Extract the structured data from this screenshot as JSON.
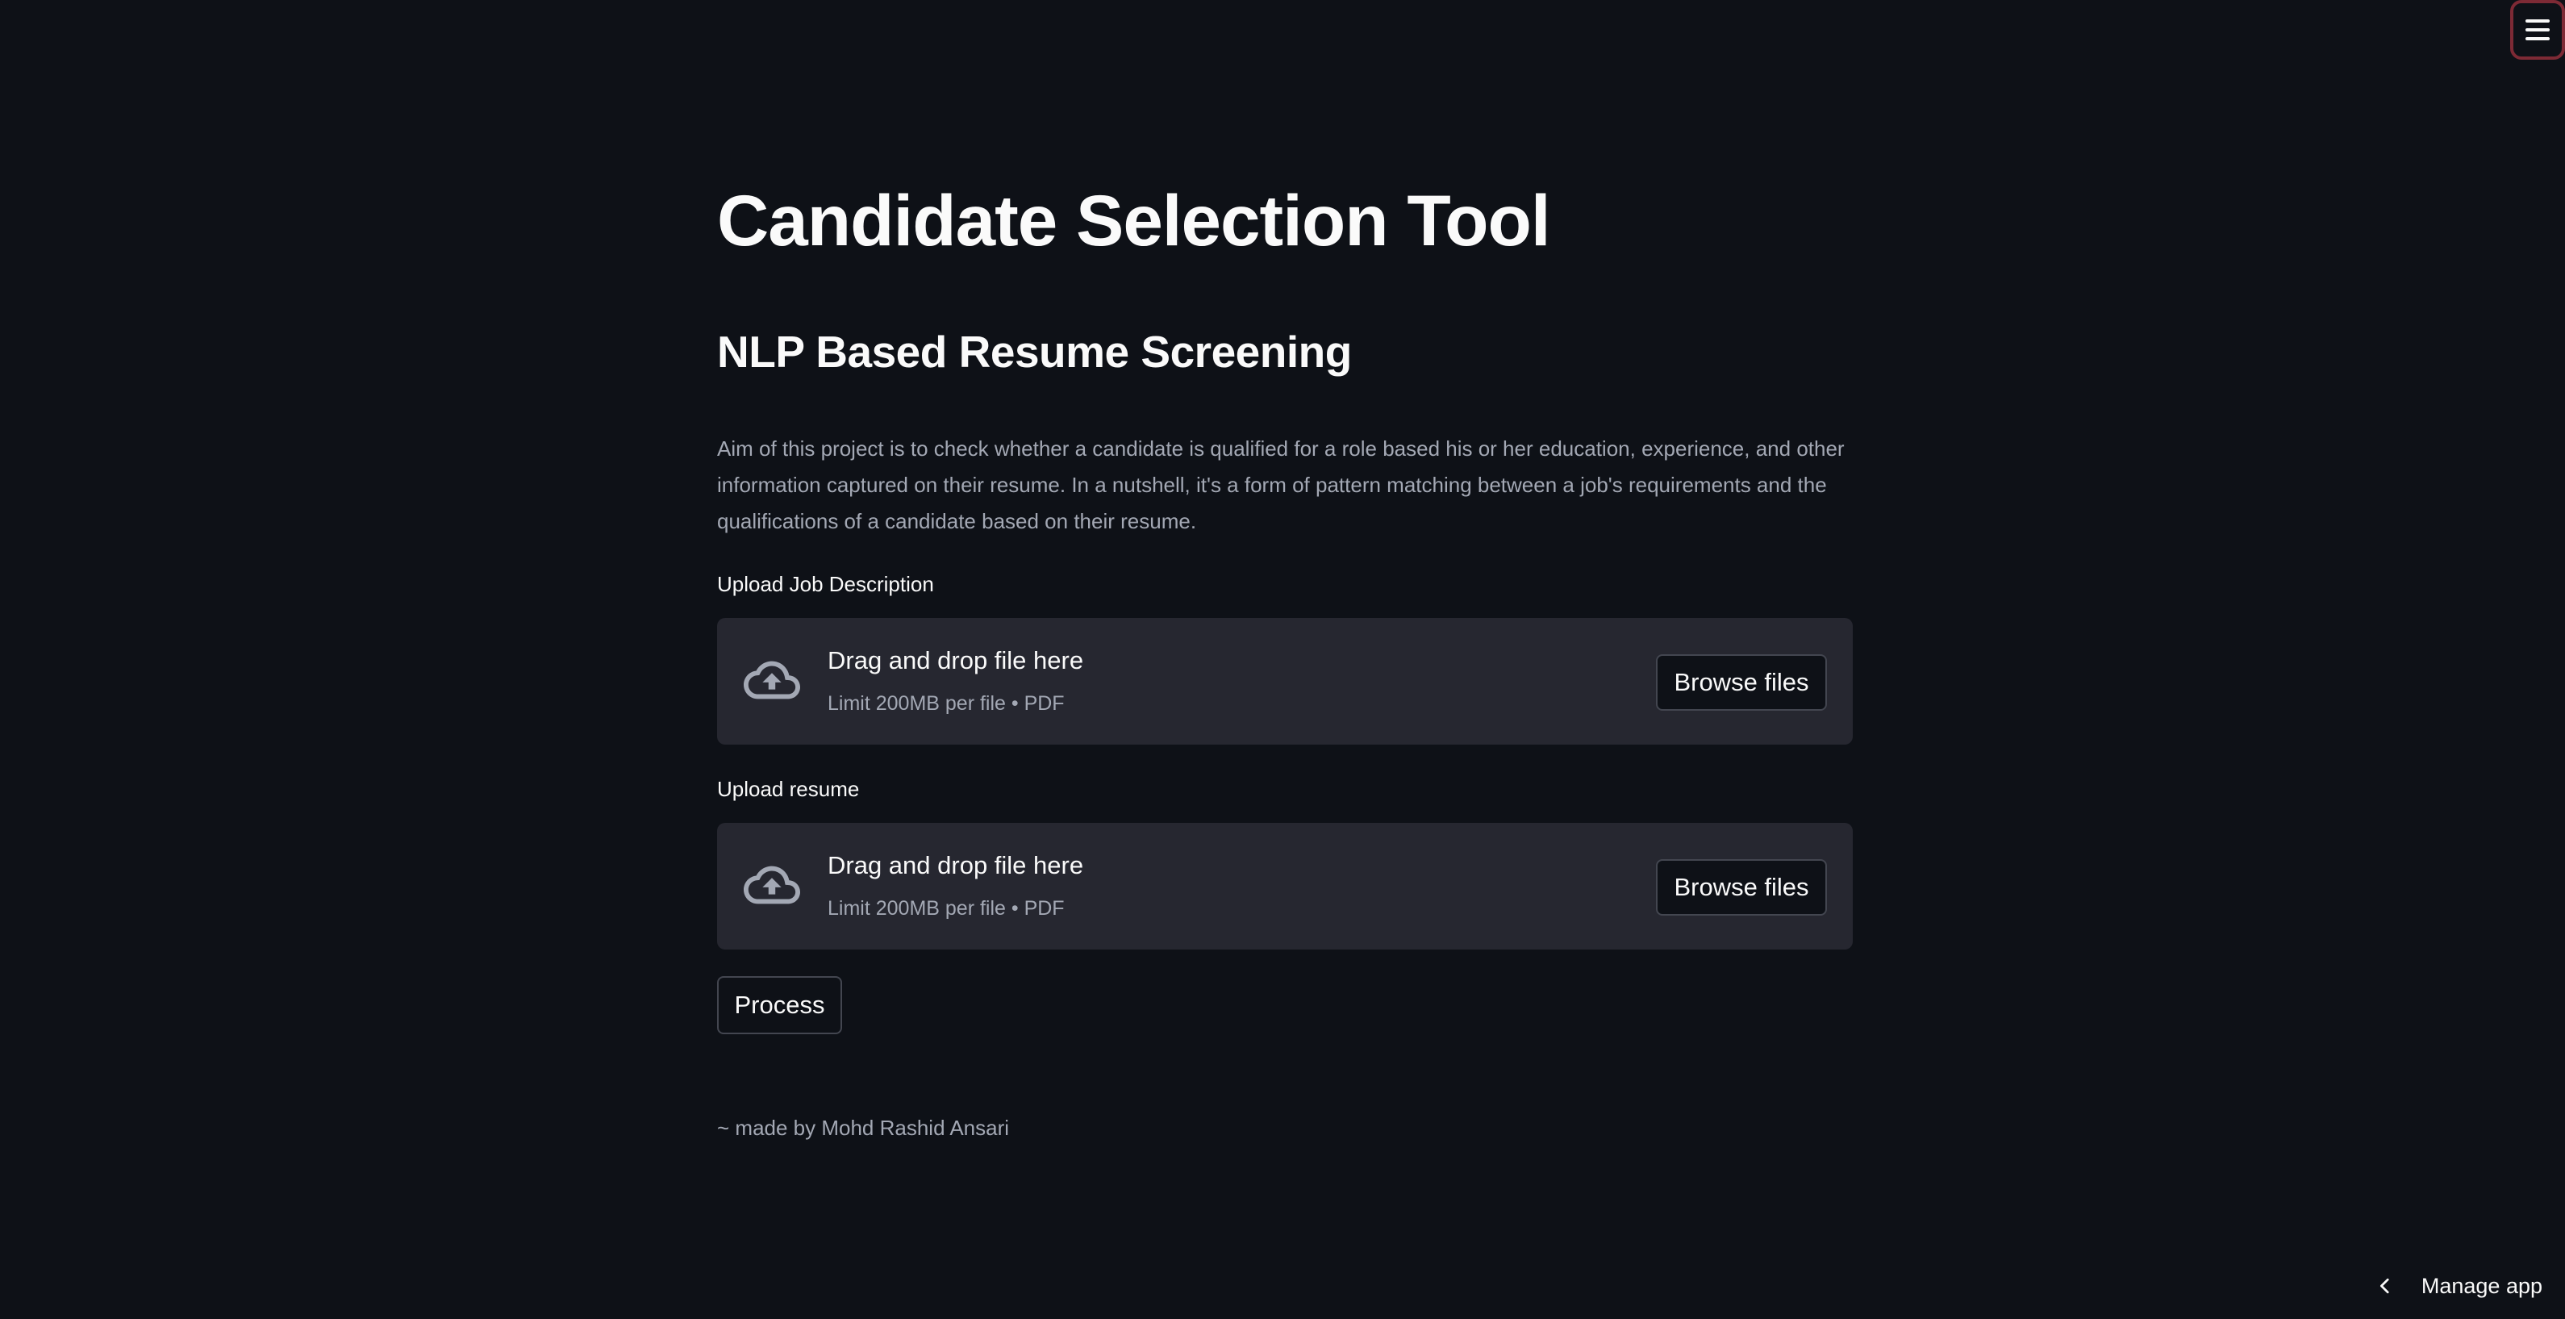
{
  "header": {
    "menu_icon": "hamburger-menu-icon",
    "menu_border_color": "#7d2a35"
  },
  "main": {
    "title": "Candidate Selection Tool",
    "subtitle": "NLP Based Resume Screening",
    "description": "Aim of this project is to check whether a candidate is qualified for a role based his or her education, experience, and other information captured on their resume. In a nutshell, it's a form of pattern matching between a job's requirements and the qualifications of a candidate based on their resume.",
    "uploads": [
      {
        "label": "Upload Job Description",
        "drop_title": "Drag and drop file here",
        "drop_limit": "Limit 200MB per file • PDF",
        "button_label": "Browse files",
        "icon": "cloud-upload-icon"
      },
      {
        "label": "Upload resume",
        "drop_title": "Drag and drop file here",
        "drop_limit": "Limit 200MB per file • PDF",
        "button_label": "Browse files",
        "icon": "cloud-upload-icon"
      }
    ],
    "process_label": "Process",
    "footer_credit": "~ made by Mohd Rashid Ansari"
  },
  "footer": {
    "manage_app_label": "Manage app",
    "manage_icon": "chevron-left-icon"
  },
  "colors": {
    "background": "#0e1117",
    "dropzone_background": "#262730",
    "text_primary": "#fafafa",
    "text_secondary": "#a3a8b4"
  }
}
